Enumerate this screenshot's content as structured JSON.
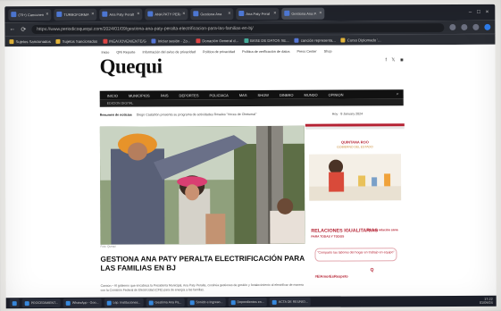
{
  "browser": {
    "tabs": [
      {
        "label": "(70+) Cancunen"
      },
      {
        "label": "TURBOFORMA"
      },
      {
        "label": "Ana Paty Peralt"
      },
      {
        "label": "ANA PATY PERA"
      },
      {
        "label": "Gestiona Ana"
      },
      {
        "label": "Ana Paty Peral"
      },
      {
        "label": "Gestiona Ana P."
      }
    ],
    "url": "https://www.periodicoquequi.com/2024/01/09/gestiona-ana-paty-peralta-electrificacion-para-las-familias-en-bj/",
    "bookmarks": [
      "Sujetos Sancionados",
      "Sujetos Sancionados",
      "INEA/JOVEN/ENTE/G",
      "Iniciar sesión - Zo...",
      "Donación General d...",
      "BASE DE DATOS SE...",
      "canción representa...",
      "Curso Diplomado '..."
    ]
  },
  "site": {
    "topnav": [
      "Inicio",
      "QRi Reporte",
      "Información del aviso de privacidad",
      "Política de privacidad",
      "Política de verificación de datos",
      "Press Center",
      "Shop"
    ],
    "logo": "Quequi",
    "mainnav": [
      "INICIO",
      "MUNICIPIOS",
      "PAIS",
      "DEPORTES",
      "POLICIACA",
      "MAS",
      "SHOW",
      "DINERO",
      "MUNDO",
      "OPINION"
    ],
    "subnav": "EDICION DIGITAL",
    "ticker_label": "Resumen de noticias",
    "ticker_text": "Diego Castañón presenta su programa de actividades Rosales \"Voces de Chetumal\"",
    "date_text": "Hoy · 8 January 2024",
    "article": {
      "headline": "GESTIONA ANA PATY PERALTA ELECTRIFICACIÓN PARA LAS FAMILIAS EN BJ",
      "lead": "Cancún.– Al gobierno que encabeza la Presidenta Municipal, Ana Paty Peralta, continúa gestiones de gestión y fortalecimiento al electrificar de manera con la Comisión Federal de Electricidad (CFE) para de energía a las familias.",
      "photo_credit": "Foto: Quequi"
    },
    "ad": {
      "gov": "QUINTANA ROO",
      "gov_sub": "GOBIERNO DEL ESTADO",
      "title": "RELACIONES IGUALITARIAS",
      "title_sub": "PARA TODAS Y TODOS",
      "side": "Por una relación sana",
      "quote": "\"Comparto las labores del hogar en trabajo en equipo\"",
      "hashtag": "#ElAmorEsRespeto",
      "logo": "Q"
    }
  },
  "taskbar": {
    "items": [
      "PROCEDIMIENT...",
      "WhatsApp - Goo...",
      "Lep. Instituciones...",
      "Gestiona Ana Pa...",
      "Sonido e Ingreso...",
      "Dependientes en...",
      "ACTA DE REUNIO..."
    ],
    "clock": "17:22",
    "date": "01/09/24"
  }
}
